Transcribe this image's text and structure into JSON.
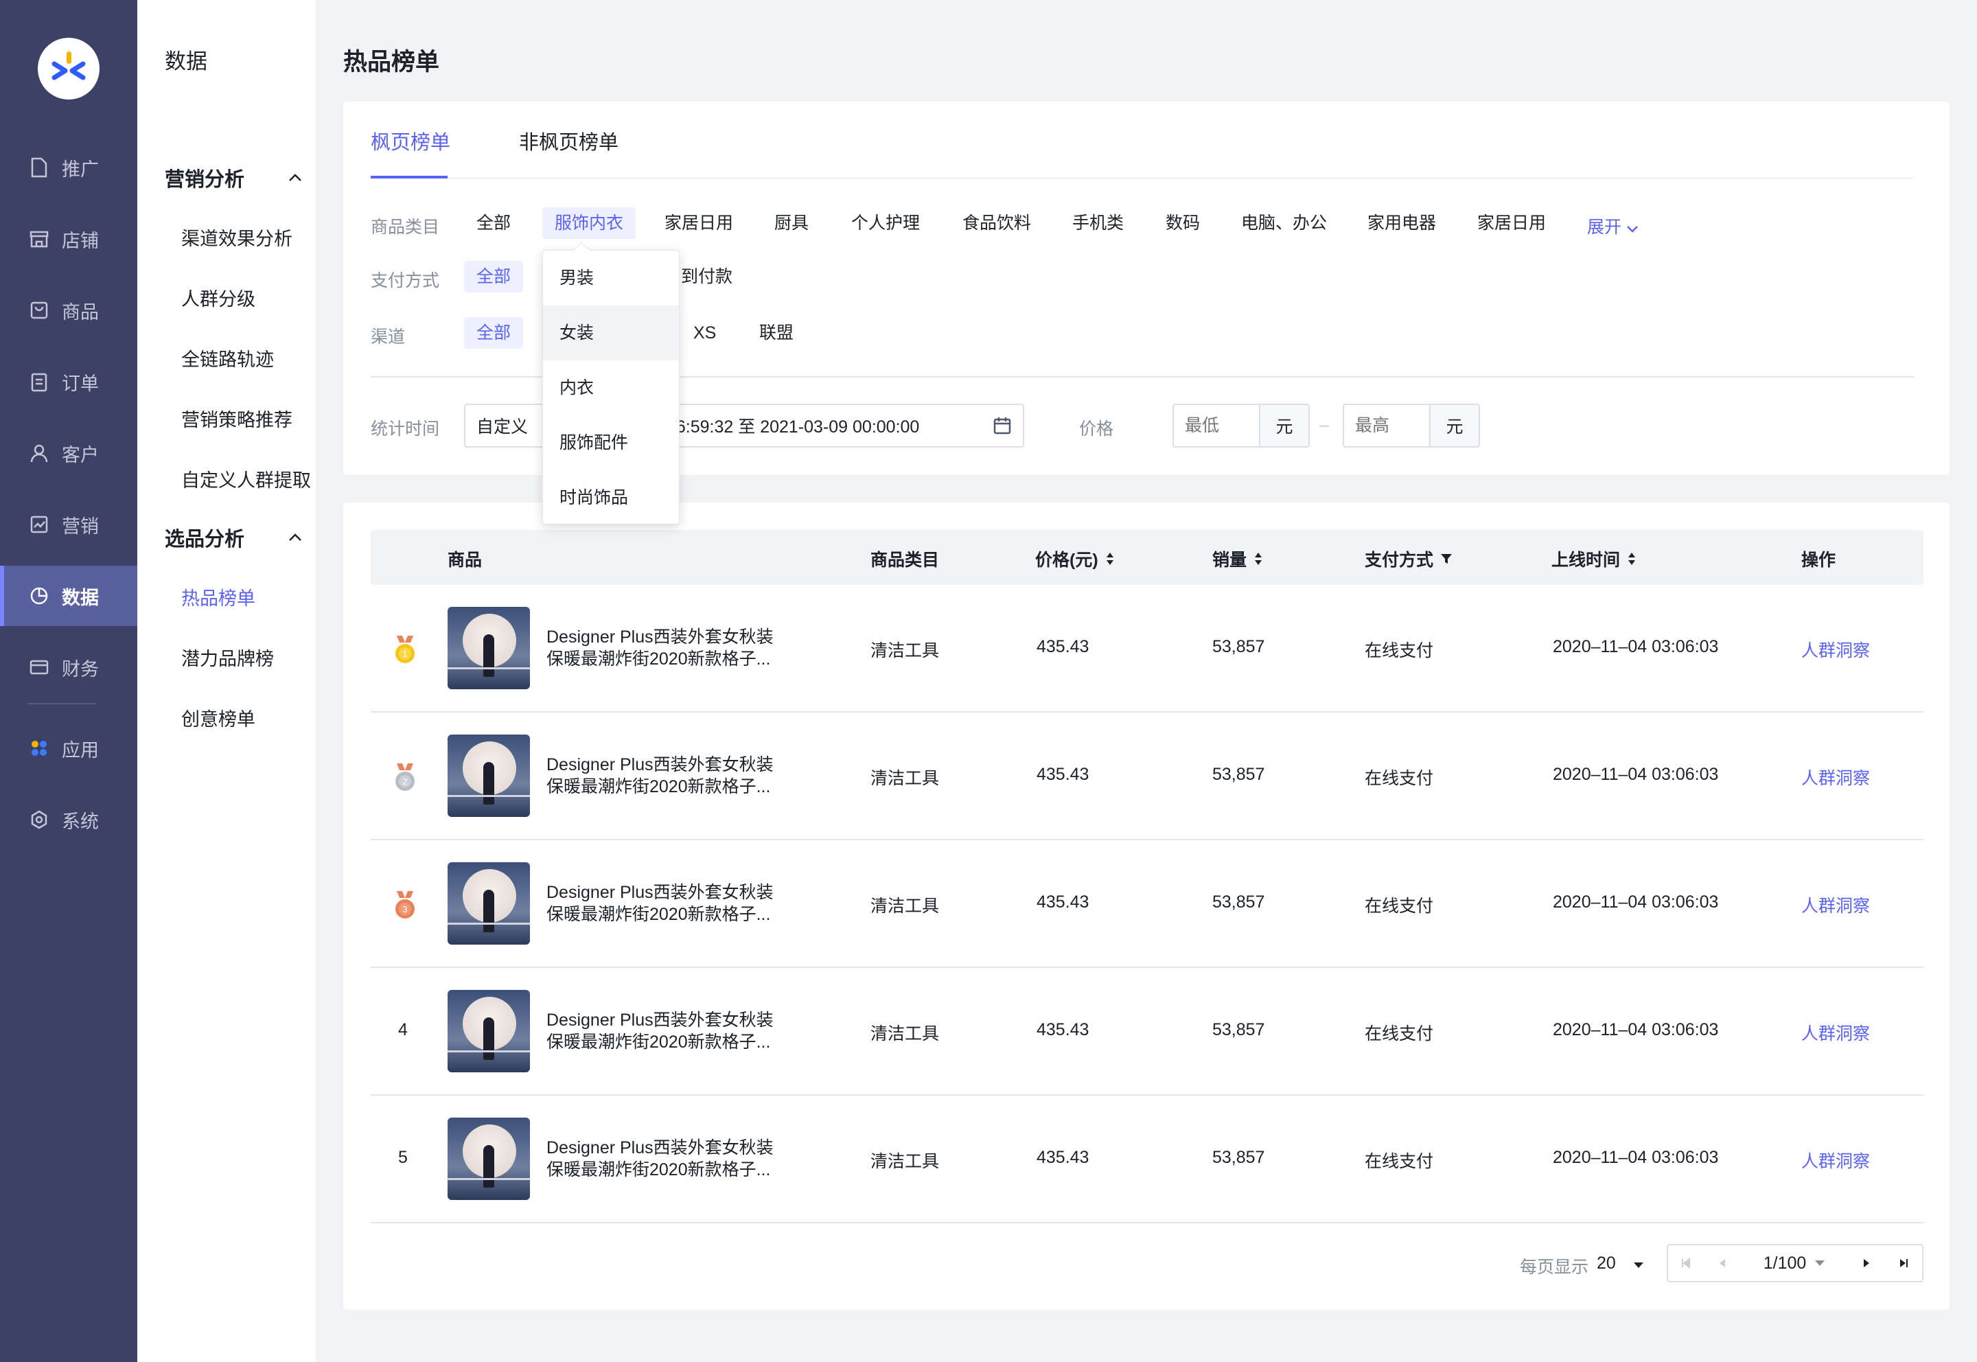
{
  "nav": {
    "items": [
      {
        "label": "推广",
        "icon": "file-icon"
      },
      {
        "label": "店铺",
        "icon": "store-icon"
      },
      {
        "label": "商品",
        "icon": "bag-icon"
      },
      {
        "label": "订单",
        "icon": "clipboard-icon"
      },
      {
        "label": "客户",
        "icon": "user-icon"
      },
      {
        "label": "营销",
        "icon": "chart-line-icon"
      },
      {
        "label": "数据",
        "icon": "pie-chart-icon"
      },
      {
        "label": "财务",
        "icon": "card-icon"
      },
      {
        "label": "应用",
        "icon": "apps-icon"
      },
      {
        "label": "系统",
        "icon": "settings-icon"
      }
    ]
  },
  "subnav": {
    "title": "数据",
    "group1": "营销分析",
    "group1_items": [
      "渠道效果分析",
      "人群分级",
      "全链路轨迹",
      "营销策略推荐",
      "自定义人群提取"
    ],
    "group2": "选品分析",
    "group2_items": [
      "热品榜单",
      "潜力品牌榜",
      "创意榜单"
    ]
  },
  "page_title": "热品榜单",
  "tabs": [
    "枫页榜单",
    "非枫页榜单"
  ],
  "filters": {
    "category_label": "商品类目",
    "categories": [
      "全部",
      "服饰内衣",
      "家居日用",
      "厨具",
      "个人护理",
      "食品饮料",
      "手机类",
      "数码",
      "电脑、办公",
      "家用电器",
      "家居日用"
    ],
    "expand": "展开",
    "payment_label": "支付方式",
    "payment_all": "全部",
    "payment_cod": "到付款",
    "channel_label": "渠道",
    "channel_all": "全部",
    "channel_xs": "XS",
    "channel_union": "联盟",
    "time_label": "统计时间",
    "time_mode": "自定义",
    "time_range": "3-08 16:59:32 至 2021-03-09 00:00:00",
    "price_label": "价格",
    "price_min_placeholder": "最低",
    "price_max_placeholder": "最高",
    "unit": "元",
    "dash": "–"
  },
  "dropdown": [
    "男装",
    "女装",
    "内衣",
    "服饰配件",
    "时尚饰品"
  ],
  "table": {
    "headers": [
      "商品",
      "商品类目",
      "价格(元)",
      "销量",
      "支付方式",
      "上线时间",
      "操作"
    ],
    "rows": [
      {
        "rank": "1",
        "name1": "Designer Plus西装外套女秋装",
        "name2": "保暖最潮炸街2020新款格子...",
        "category": "清洁工具",
        "price": "435.43",
        "sales": "53,857",
        "payment": "在线支付",
        "time": "2020–11–04 03:06:03",
        "action": "人群洞察"
      },
      {
        "rank": "2",
        "name1": "Designer Plus西装外套女秋装",
        "name2": "保暖最潮炸街2020新款格子...",
        "category": "清洁工具",
        "price": "435.43",
        "sales": "53,857",
        "payment": "在线支付",
        "time": "2020–11–04 03:06:03",
        "action": "人群洞察"
      },
      {
        "rank": "3",
        "name1": "Designer Plus西装外套女秋装",
        "name2": "保暖最潮炸街2020新款格子...",
        "category": "清洁工具",
        "price": "435.43",
        "sales": "53,857",
        "payment": "在线支付",
        "time": "2020–11–04 03:06:03",
        "action": "人群洞察"
      },
      {
        "rank": "4",
        "name1": "Designer Plus西装外套女秋装",
        "name2": "保暖最潮炸街2020新款格子...",
        "category": "清洁工具",
        "price": "435.43",
        "sales": "53,857",
        "payment": "在线支付",
        "time": "2020–11–04 03:06:03",
        "action": "人群洞察"
      },
      {
        "rank": "5",
        "name1": "Designer Plus西装外套女秋装",
        "name2": "保暖最潮炸街2020新款格子...",
        "category": "清洁工具",
        "price": "435.43",
        "sales": "53,857",
        "payment": "在线支付",
        "time": "2020–11–04 03:06:03",
        "action": "人群洞察"
      }
    ]
  },
  "pagination": {
    "per_page_label": "每页显示",
    "per_page": "20",
    "page": "1/100"
  },
  "colors": {
    "accent": "#5b63f5",
    "nav_bg": "#3e4166",
    "gold": "#f5c518",
    "silver": "#b8bcc6",
    "bronze": "#e9825a"
  }
}
